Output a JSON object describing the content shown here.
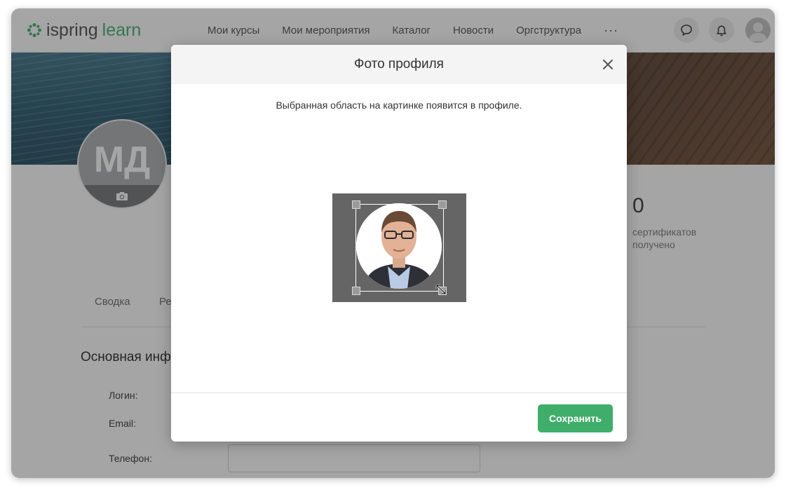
{
  "app": {
    "logo": {
      "part1": "ispring",
      "part2": "learn"
    },
    "nav": {
      "items": [
        "Мои курсы",
        "Мои мероприятия",
        "Каталог",
        "Новости",
        "Оргструктура"
      ],
      "more": "···"
    },
    "header_icons": [
      "chat-icon",
      "bell-icon",
      "user-avatar-icon"
    ]
  },
  "profile": {
    "initials": "МД",
    "camera_icon": "camera-icon",
    "stats": {
      "value": "0",
      "label": "сертификатов получено"
    },
    "tabs": [
      "Сводка",
      "Ре"
    ],
    "section_title": "Основная инф",
    "fields": {
      "login": "Логин:",
      "email": "Email:",
      "phone": "Телефон:"
    }
  },
  "modal": {
    "title": "Фото профиля",
    "hint": "Выбранная область на картинке появится в профиле.",
    "close_icon": "close-icon",
    "save_label": "Сохранить"
  },
  "colors": {
    "accent": "#3fae6a",
    "overlay": "rgba(40,40,40,0.42)"
  }
}
